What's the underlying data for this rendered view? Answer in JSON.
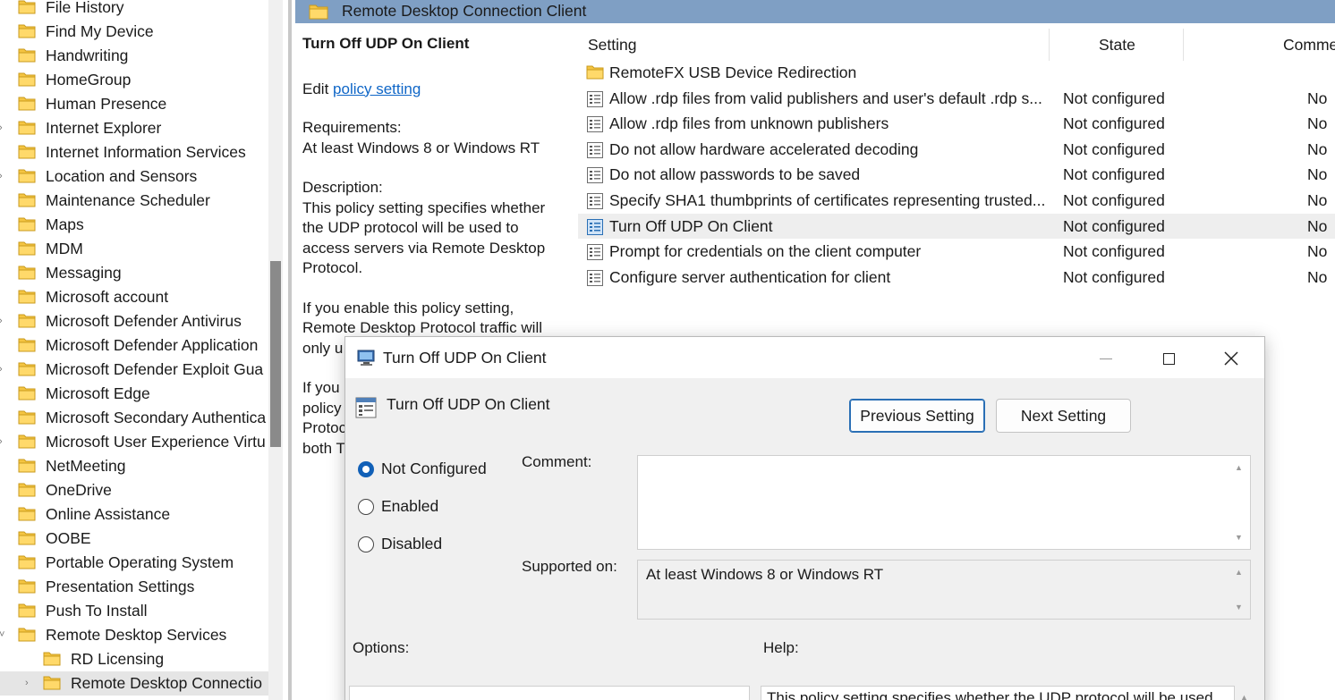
{
  "tree": {
    "items": [
      {
        "label": "File History",
        "expandable": false
      },
      {
        "label": "Find My Device",
        "expandable": false
      },
      {
        "label": "Handwriting",
        "expandable": false
      },
      {
        "label": "HomeGroup",
        "expandable": false
      },
      {
        "label": "Human Presence",
        "expandable": false
      },
      {
        "label": "Internet Explorer",
        "expandable": true
      },
      {
        "label": "Internet Information Services",
        "expandable": false
      },
      {
        "label": "Location and Sensors",
        "expandable": true
      },
      {
        "label": "Maintenance Scheduler",
        "expandable": false
      },
      {
        "label": "Maps",
        "expandable": false
      },
      {
        "label": "MDM",
        "expandable": false
      },
      {
        "label": "Messaging",
        "expandable": false
      },
      {
        "label": "Microsoft account",
        "expandable": false
      },
      {
        "label": "Microsoft Defender Antivirus",
        "expandable": true
      },
      {
        "label": "Microsoft Defender Application",
        "expandable": false
      },
      {
        "label": "Microsoft Defender Exploit Gua",
        "expandable": true
      },
      {
        "label": "Microsoft Edge",
        "expandable": false
      },
      {
        "label": "Microsoft Secondary Authentica",
        "expandable": false
      },
      {
        "label": "Microsoft User Experience Virtu",
        "expandable": true
      },
      {
        "label": "NetMeeting",
        "expandable": false
      },
      {
        "label": "OneDrive",
        "expandable": false
      },
      {
        "label": "Online Assistance",
        "expandable": false
      },
      {
        "label": "OOBE",
        "expandable": false
      },
      {
        "label": "Portable Operating System",
        "expandable": false
      },
      {
        "label": "Presentation Settings",
        "expandable": false
      },
      {
        "label": "Push To Install",
        "expandable": false
      },
      {
        "label": "Remote Desktop Services",
        "expandable": true,
        "expanded": true
      },
      {
        "label": "RD Licensing",
        "expandable": false,
        "child": true
      },
      {
        "label": "Remote Desktop Connectio",
        "expandable": true,
        "child": true,
        "selected": true
      },
      {
        "label": "",
        "expandable": false,
        "child": true
      }
    ]
  },
  "header": {
    "title": "Remote Desktop Connection Client"
  },
  "description": {
    "title": "Turn Off UDP On Client",
    "edit_prefix": "Edit",
    "edit_link": "policy setting",
    "requirements_label": "Requirements:",
    "requirements_value": "At least Windows 8 or Windows RT",
    "description_label": "Description:",
    "description_text": "This policy setting specifies whether the UDP protocol will be used to access servers via Remote Desktop Protocol.",
    "enable_text": "If you enable this policy setting, Remote Desktop Protocol traffic will only u",
    "disable_text": "If you policy Protoc both T"
  },
  "list": {
    "columns": {
      "setting": "Setting",
      "state": "State",
      "comment": "Comme"
    },
    "rows": [
      {
        "icon": "folder-icon",
        "setting": "RemoteFX USB Device Redirection",
        "state": "",
        "comment": ""
      },
      {
        "icon": "policy-icon",
        "setting": "Allow .rdp files from valid publishers and user's default .rdp s...",
        "state": "Not configured",
        "comment": "No"
      },
      {
        "icon": "policy-icon",
        "setting": "Allow .rdp files from unknown publishers",
        "state": "Not configured",
        "comment": "No"
      },
      {
        "icon": "policy-icon",
        "setting": "Do not allow hardware accelerated decoding",
        "state": "Not configured",
        "comment": "No"
      },
      {
        "icon": "policy-icon",
        "setting": "Do not allow passwords to be saved",
        "state": "Not configured",
        "comment": "No"
      },
      {
        "icon": "policy-icon",
        "setting": "Specify SHA1 thumbprints of certificates representing trusted...",
        "state": "Not configured",
        "comment": "No"
      },
      {
        "icon": "policy-icon",
        "setting": "Turn Off UDP On Client",
        "state": "Not configured",
        "comment": "No",
        "selected": true
      },
      {
        "icon": "policy-icon",
        "setting": "Prompt for credentials on the client computer",
        "state": "Not configured",
        "comment": "No"
      },
      {
        "icon": "policy-icon",
        "setting": "Configure server authentication for client",
        "state": "Not configured",
        "comment": "No"
      }
    ]
  },
  "dialog": {
    "title": "Turn Off UDP On Client",
    "policy_name": "Turn Off UDP On Client",
    "prev_label": "Previous Setting",
    "next_label": "Next Setting",
    "radios": {
      "not_configured": "Not Configured",
      "enabled": "Enabled",
      "disabled": "Disabled",
      "selected": "not_configured"
    },
    "comment_label": "Comment:",
    "comment_value": "",
    "supported_label": "Supported on:",
    "supported_value": "At least Windows 8 or Windows RT",
    "options_label": "Options:",
    "help_label": "Help:",
    "help_text": "This policy setting specifies whether the UDP protocol will be used"
  },
  "colors": {
    "header_band": "#7f9fc4",
    "link": "#0f66c7",
    "radio_accent": "#1160b7",
    "folder": "#f5c542"
  }
}
